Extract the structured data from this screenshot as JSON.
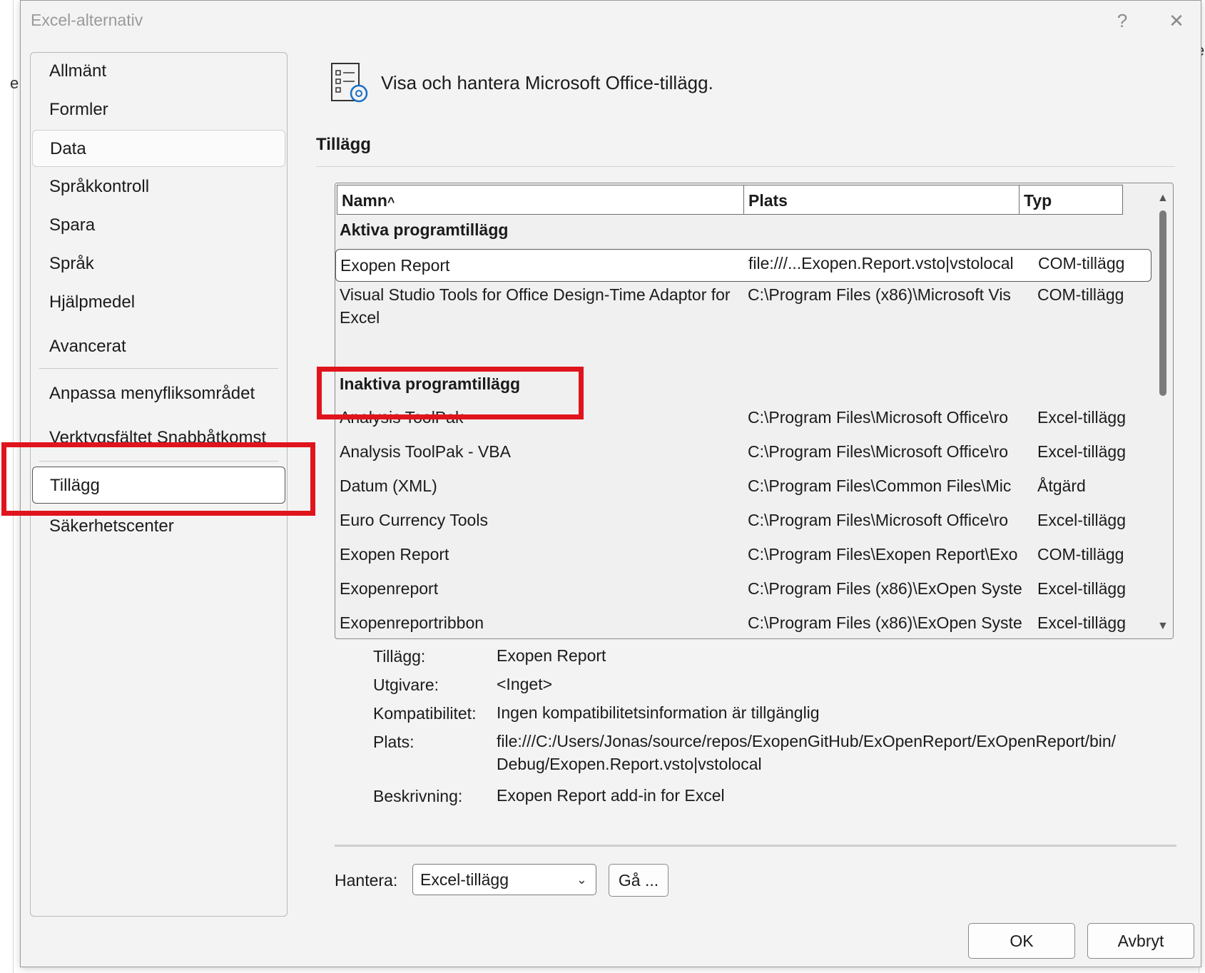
{
  "window": {
    "title": "Excel-alternativ",
    "help": "?",
    "close": "✕"
  },
  "background": {
    "fragment_left": "e",
    "fragment_right": "e"
  },
  "nav": {
    "items": [
      {
        "label": "Allmänt"
      },
      {
        "label": "Formler"
      },
      {
        "label": "Data"
      },
      {
        "label": "Språkkontroll"
      },
      {
        "label": "Spara"
      },
      {
        "label": "Språk"
      },
      {
        "label": "Hjälpmedel"
      },
      {
        "label": "Avancerat"
      },
      {
        "label": "Anpassa menyfliksområdet"
      },
      {
        "label": "Verktygsfältet Snabbåtkomst"
      },
      {
        "label": "Tillägg"
      },
      {
        "label": "Säkerhetscenter"
      }
    ]
  },
  "header": {
    "text": "Visa och hantera Microsoft Office-tillägg."
  },
  "section": {
    "title": "Tillägg"
  },
  "table": {
    "columns": {
      "name": "Namn",
      "sort_indicator": "^",
      "location": "Plats",
      "type": "Typ"
    },
    "groups": [
      {
        "title": "Aktiva programtillägg",
        "rows": [
          {
            "name": "Exopen Report",
            "location": "file:///...Exopen.Report.vsto|vstolocal",
            "type": "COM-tillägg"
          },
          {
            "name": "Visual Studio Tools for Office Design-Time Adaptor for Excel",
            "location": "C:\\Program Files (x86)\\Microsoft Vis",
            "type": "COM-tillägg"
          }
        ]
      },
      {
        "title": "Inaktiva programtillägg",
        "rows": [
          {
            "name": "Analysis ToolPak",
            "location": "C:\\Program Files\\Microsoft Office\\ro",
            "type": "Excel-tillägg"
          },
          {
            "name": "Analysis ToolPak - VBA",
            "location": "C:\\Program Files\\Microsoft Office\\ro",
            "type": "Excel-tillägg"
          },
          {
            "name": "Datum (XML)",
            "location": "C:\\Program Files\\Common Files\\Mic",
            "type": "Åtgärd"
          },
          {
            "name": "Euro Currency Tools",
            "location": "C:\\Program Files\\Microsoft Office\\ro",
            "type": "Excel-tillägg"
          },
          {
            "name": "Exopen Report",
            "location": "C:\\Program Files\\Exopen Report\\Exo",
            "type": "COM-tillägg"
          },
          {
            "name": "Exopenreport",
            "location": "C:\\Program Files (x86)\\ExOpen Syste",
            "type": "Excel-tillägg"
          },
          {
            "name": "Exopenreportribbon",
            "location": "C:\\Program Files (x86)\\ExOpen Syste",
            "type": "Excel-tillägg"
          }
        ]
      }
    ]
  },
  "details": {
    "addin": {
      "label": "Tillägg:",
      "value": "Exopen Report"
    },
    "publisher": {
      "label": "Utgivare:",
      "value": "<Inget>"
    },
    "compat": {
      "label": "Kompatibilitet:",
      "value": "Ingen kompatibilitetsinformation är tillgänglig"
    },
    "location": {
      "label": "Plats:",
      "value_line1": "file:///C:/Users/Jonas/source/repos/ExopenGitHub/ExOpenReport/ExOpenReport/bin/",
      "value_line2": "Debug/Exopen.Report.vsto|vstolocal"
    },
    "description": {
      "label": "Beskrivning:",
      "value": "Exopen Report add-in for Excel"
    }
  },
  "manage": {
    "label": "Hantera:",
    "selected": "Excel-tillägg",
    "go_label": "Gå ..."
  },
  "footer": {
    "ok_label": "OK",
    "cancel_label": "Avbryt"
  },
  "colors": {
    "highlight": "#e0141c",
    "dialog_bg": "#f3f3f3"
  }
}
